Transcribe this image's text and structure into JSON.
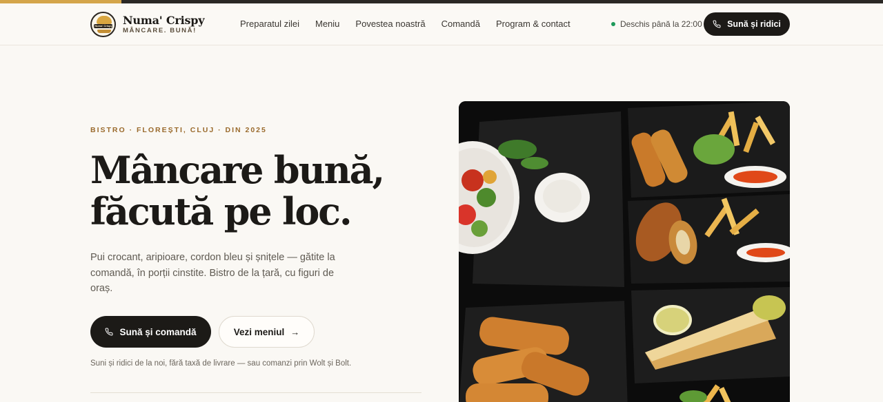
{
  "brand": {
    "name": "Numa' Crispy",
    "tagline": "MÂNCARE. BUNĂ!",
    "logo_band_text": "Numa' Crispy"
  },
  "nav": {
    "items": [
      {
        "label": "Preparatul zilei"
      },
      {
        "label": "Meniu"
      },
      {
        "label": "Povestea noastră"
      },
      {
        "label": "Comandă"
      },
      {
        "label": "Program & contact"
      }
    ]
  },
  "header": {
    "open_status": "Deschis până la 22:00",
    "call_button": "Sună și ridici",
    "status_color": "#1e9a5b"
  },
  "hero": {
    "eyebrow": "BISTRO · FLOREȘTI, CLUJ · DIN 2025",
    "title_line1": "Mâncare bună,",
    "title_line2": "făcută pe loc.",
    "lead": "Pui crocant, aripioare, cordon bleu și șnițele — gătite la comandă, în porții cinstite. Bistro de la țară, cu figuri de oraș.",
    "primary_cta": "Sună și comandă",
    "secondary_cta": "Vezi meniul",
    "note": "Suni și ridici de la noi, fără taxă de livrare — sau comanzi prin Wolt și Bolt."
  },
  "icons": {
    "phone": "phone-icon",
    "arrow": "arrow-right-icon",
    "status": "status-dot-icon"
  },
  "colors": {
    "accent": "#d4a54a",
    "eyebrow": "#9a6a2c",
    "dark": "#1c1a17",
    "background": "#faf8f4"
  }
}
